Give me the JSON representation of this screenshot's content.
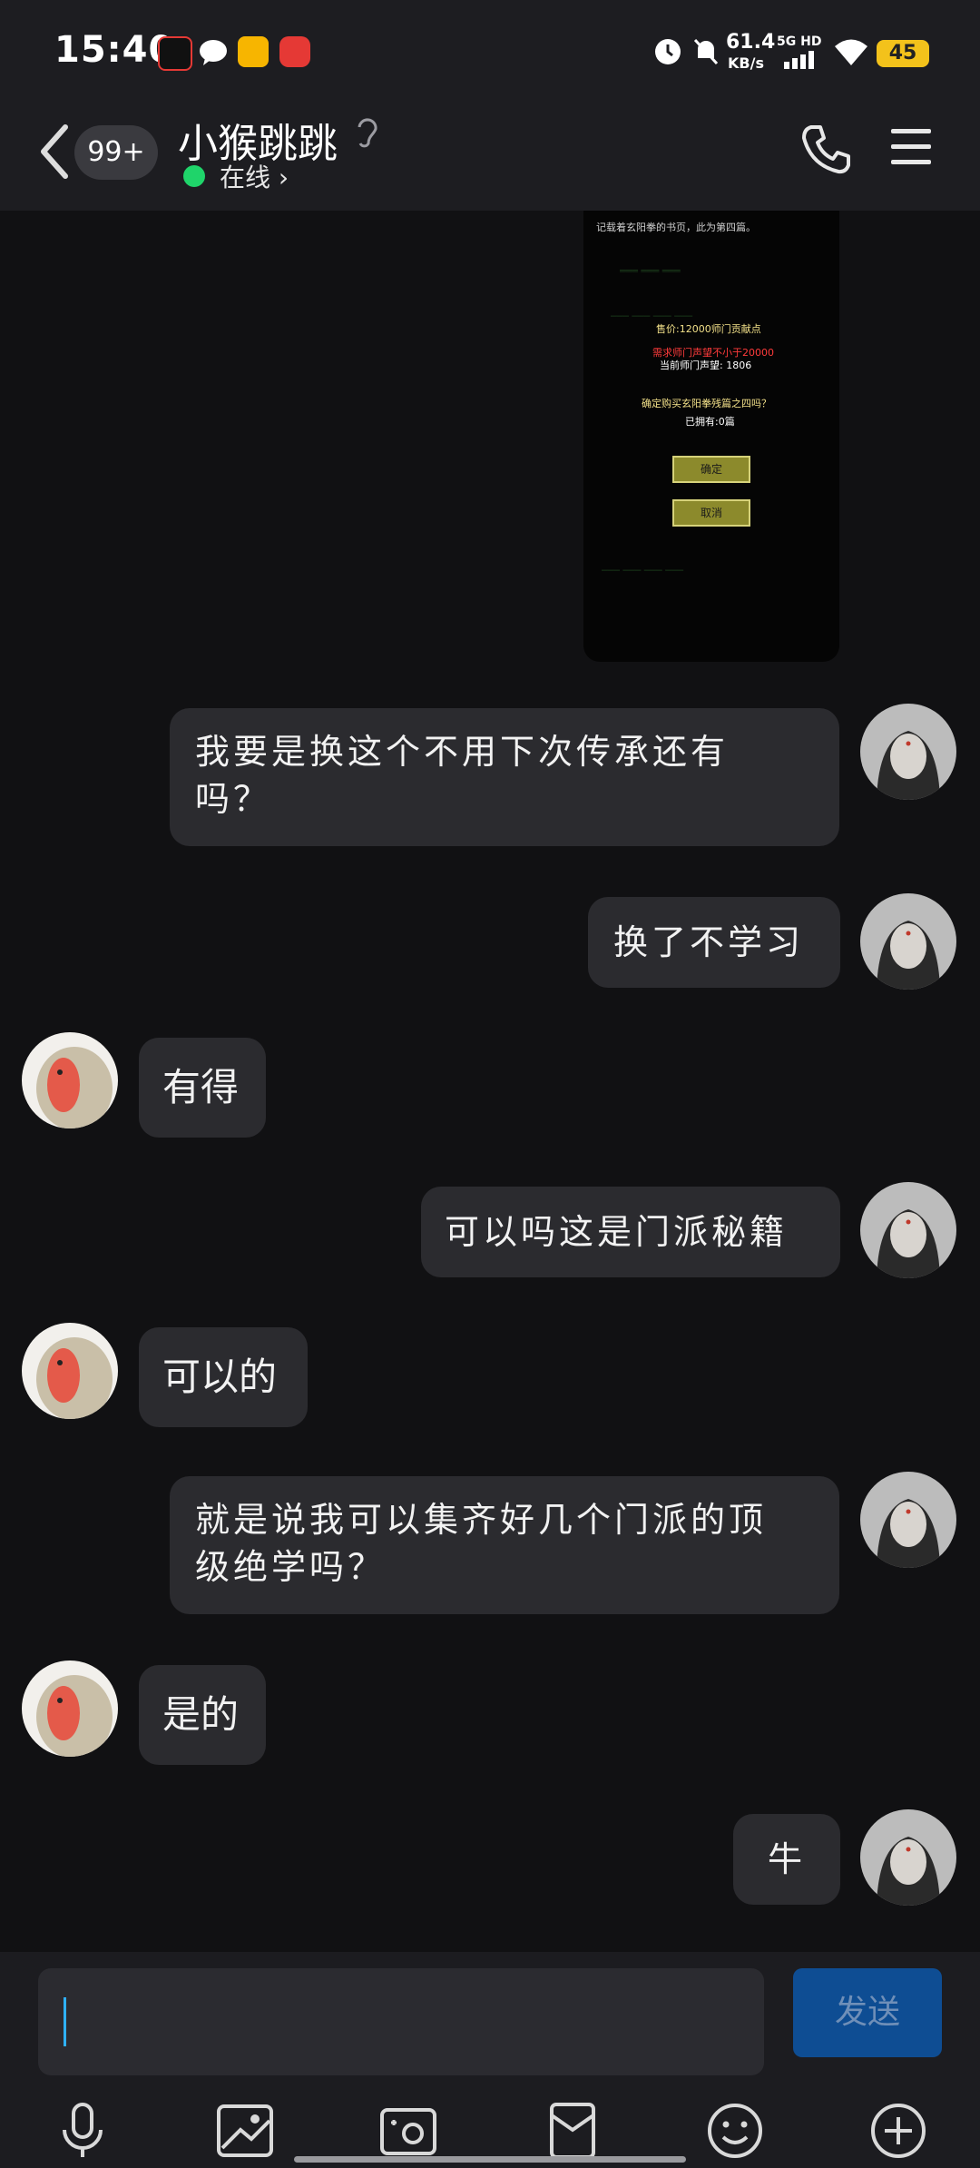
{
  "status": {
    "time": "15:40",
    "network_speed": "61.4",
    "network_unit": "KB/s",
    "network_type": "5G HD",
    "battery": "45"
  },
  "header": {
    "unread_badge": "99+",
    "contact_name": "小猴跳跳",
    "online_status": "在线"
  },
  "image_message": {
    "lines": [
      "记载着玄阳拳的书页，此为第四篇。",
      "售价:12000师门贡献点",
      "需求师门声望不小于20000",
      "当前师门声望: 1806",
      "确定购买玄阳拳残篇之四吗？",
      "已拥有:0篇"
    ],
    "confirm": "确定",
    "cancel": "取消"
  },
  "messages": [
    {
      "side": "sent",
      "lines": [
        "我要是换这个不用下次传承还有",
        "吗？"
      ]
    },
    {
      "side": "sent",
      "lines": [
        "换了不学习"
      ]
    },
    {
      "side": "received",
      "lines": [
        "有得"
      ]
    },
    {
      "side": "sent",
      "lines": [
        "可以吗这是门派秘籍"
      ]
    },
    {
      "side": "received",
      "lines": [
        "可以的"
      ]
    },
    {
      "side": "sent",
      "lines": [
        "就是说我可以集齐好几个门派的顶",
        "级绝学吗？"
      ]
    },
    {
      "side": "received",
      "lines": [
        "是的"
      ]
    },
    {
      "side": "sent",
      "lines": [
        "牛"
      ]
    }
  ],
  "input": {
    "send_label": "发送"
  },
  "colors": {
    "accent": "#0e4d93",
    "online": "#1fd46a",
    "battery": "#f3c21b"
  },
  "icons": [
    "back-arrow-icon",
    "ear-icon",
    "phone-icon",
    "menu-icon",
    "microphone-icon",
    "image-icon",
    "camera-icon",
    "red-packet-icon",
    "emoji-icon",
    "plus-icon"
  ]
}
